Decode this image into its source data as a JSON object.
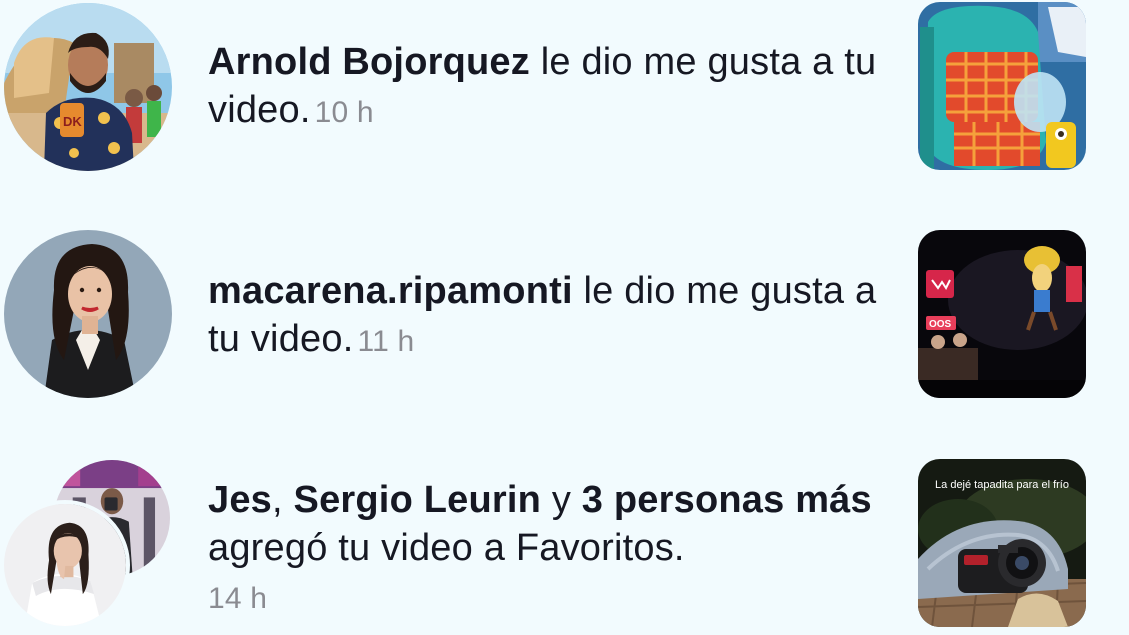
{
  "notifications": [
    {
      "actor": "Arnold Bojorquez",
      "action": " le dio me gusta a tu video.",
      "time": "10 h",
      "avatar_icon": "profile-photo",
      "thumbnail_icon": "video-thumbnail-backpack"
    },
    {
      "actor": "macarena.ripamonti",
      "action": " le dio me gusta a tu video.",
      "time": "11 h",
      "avatar_icon": "profile-photo",
      "thumbnail_icon": "video-thumbnail-stage"
    },
    {
      "actor_1": "Jes",
      "separator_1": ", ",
      "actor_2": "Sergio Leurin",
      "separator_2": " y ",
      "others": "3 personas más",
      "action": " agregó tu video a Favoritos.",
      "time": "14 h",
      "avatar_icon": "stacked-profile-photos",
      "thumbnail_caption": "La dejé tapadita para el frío",
      "thumbnail_icon": "video-thumbnail-camera"
    }
  ],
  "colors": {
    "background": "#f2fbfe",
    "text_primary": "#161823",
    "text_time": "#8a8b91"
  }
}
